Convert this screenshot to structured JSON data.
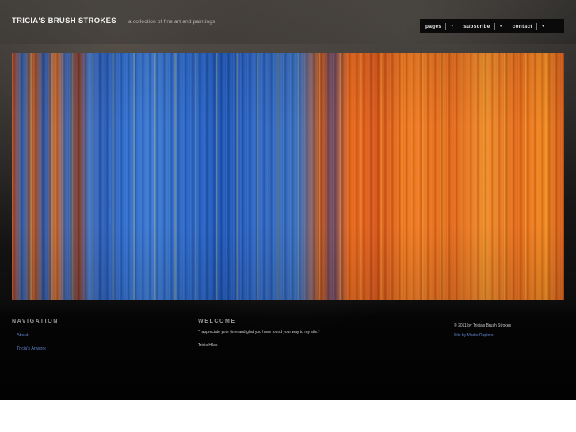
{
  "header": {
    "title": "TRICIA'S BRUSH STROKES",
    "tagline": "a collection of fine art and paintings"
  },
  "topnav": {
    "items": [
      {
        "label": "pages"
      },
      {
        "label": "subscribe"
      },
      {
        "label": "contact"
      }
    ]
  },
  "footer": {
    "navigation": {
      "heading": "NAVIGATION",
      "links": [
        {
          "label": "About"
        },
        {
          "label": "Tricia's Artwork"
        }
      ]
    },
    "welcome": {
      "heading": "WELCOME",
      "text": "\"I appreciate your time and glad you have found your way to my site.\"",
      "signature": "Tricia Hiles"
    },
    "credits": {
      "copyright": "© 2011 by Tricia's Brush Strokes",
      "site_by": "Site by MarketRaptors"
    }
  }
}
